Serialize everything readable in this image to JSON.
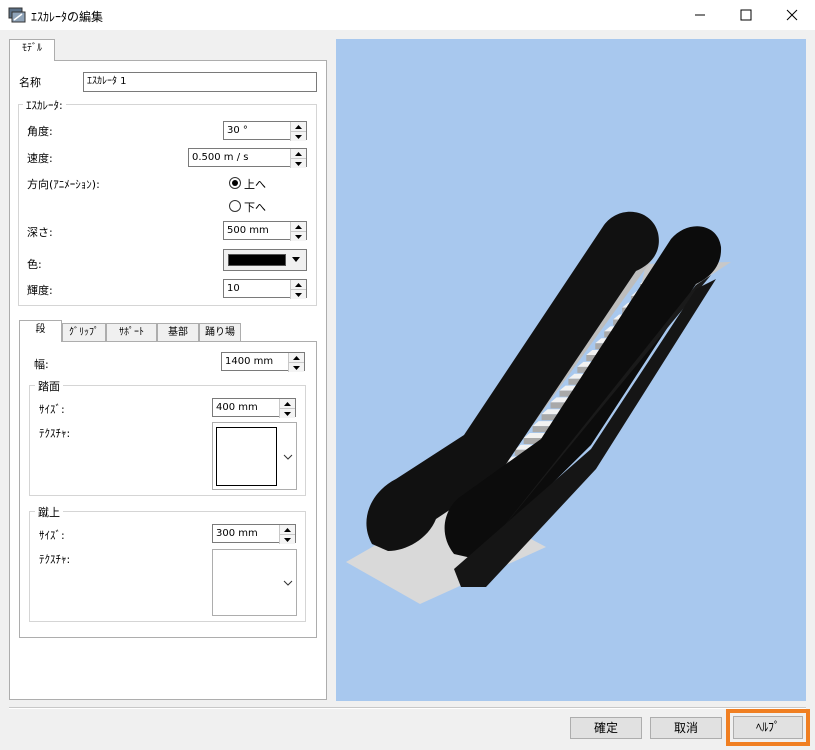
{
  "window": {
    "title": "ｴｽｶﾚｰﾀの編集",
    "minimize": "—",
    "maximize": "☐",
    "close": "✕"
  },
  "tabs": {
    "model": "ﾓﾃﾞﾙ"
  },
  "name": {
    "label": "名称",
    "value": "ｴｽｶﾚｰﾀ 1"
  },
  "escalator": {
    "title": "ｴｽｶﾚｰﾀ:",
    "angle_label": "角度:",
    "angle_value": "30 °",
    "speed_label": "速度:",
    "speed_value": "0.500 m / s",
    "direction_label": "方向(ｱﾆﾒｰｼｮﾝ):",
    "up_label": "上へ",
    "down_label": "下へ",
    "direction_selected": "上へ",
    "depth_label": "深さ:",
    "depth_value": "500 mm",
    "color_label": "色:",
    "color_value": "#000000",
    "brightness_label": "輝度:",
    "brightness_value": "10"
  },
  "subtabs": [
    "段",
    "ｸﾞﾘｯﾌﾟ",
    "ｻﾎﾟｰﾄ",
    "基部",
    "踊り場"
  ],
  "step": {
    "width_label": "幅:",
    "width_value": "1400 mm",
    "tread": {
      "title": "踏面",
      "size_label": "ｻｲｽﾞ:",
      "size_value": "400 mm",
      "texture_label": "ﾃｸｽﾁｬ:"
    },
    "riser": {
      "title": "蹴上",
      "size_label": "ｻｲｽﾞ:",
      "size_value": "300 mm",
      "texture_label": "ﾃｸｽﾁｬ:"
    }
  },
  "buttons": {
    "ok": "確定",
    "cancel": "取消",
    "help": "ﾍﾙﾌﾟ"
  },
  "preview": {
    "background": "#a8c8ee",
    "highlight": "#f07f22"
  }
}
